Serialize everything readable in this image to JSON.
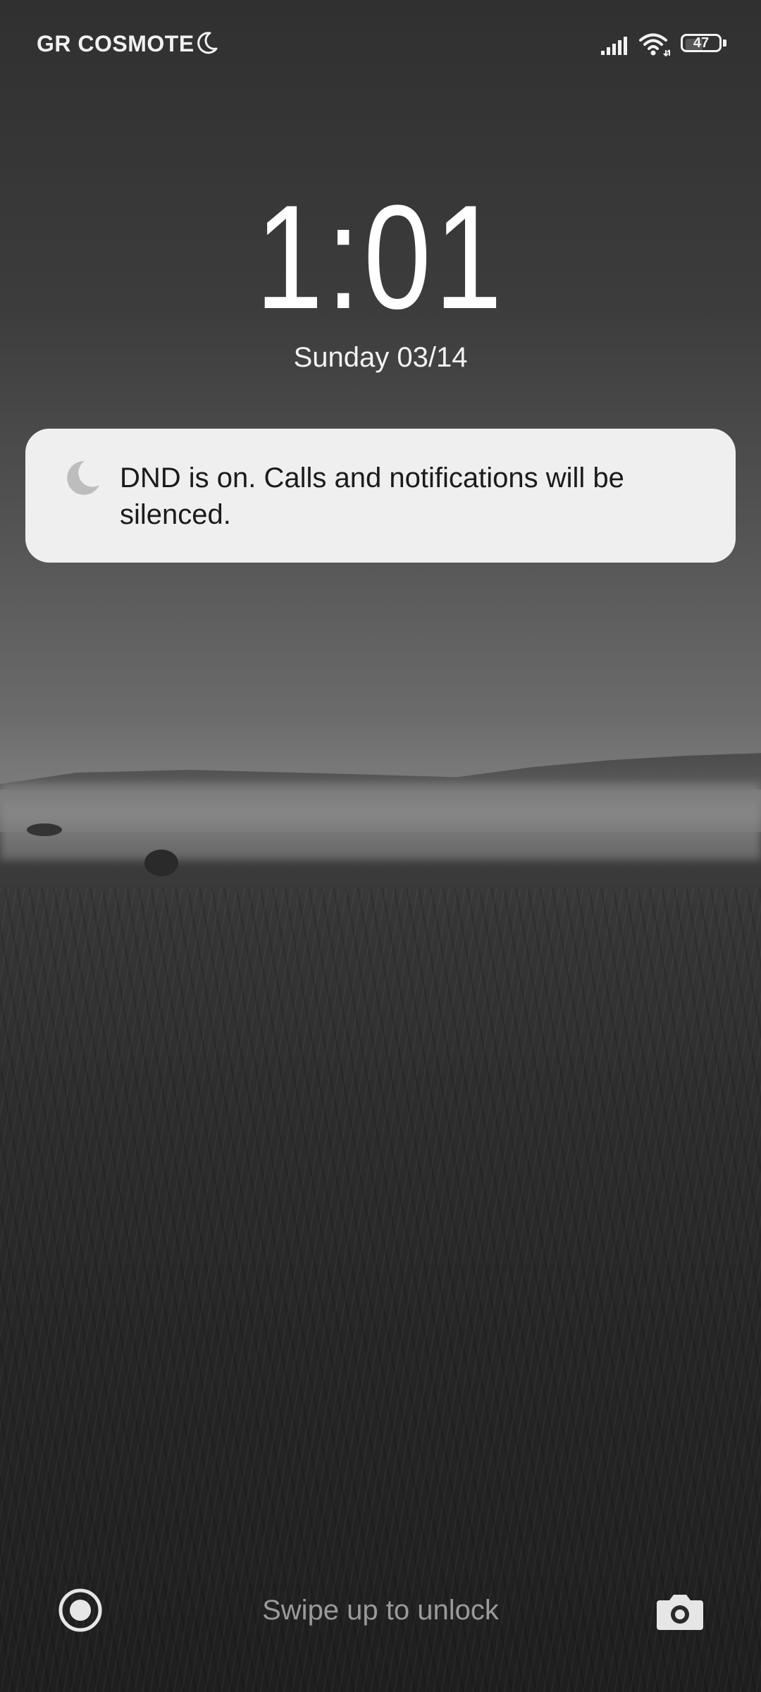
{
  "status_bar": {
    "carrier": "GR COSMOTE",
    "dnd_icon": "moon-icon",
    "signal_icon": "cellular-signal-icon",
    "wifi_icon": "wifi-icon",
    "battery_level": "47",
    "battery_fraction": 0.47
  },
  "lock_screen": {
    "time": "1:01",
    "date": "Sunday 03/14"
  },
  "notification": {
    "icon": "moon-icon",
    "text": "DND is on. Calls and notifications will be silenced."
  },
  "bottom_bar": {
    "left_icon": "record-circle-icon",
    "hint": "Swipe up to unlock",
    "right_icon": "camera-icon"
  },
  "colors": {
    "notification_bg": "#efefef",
    "text_primary": "#ffffff",
    "hint_text": "#9a9a9a"
  }
}
